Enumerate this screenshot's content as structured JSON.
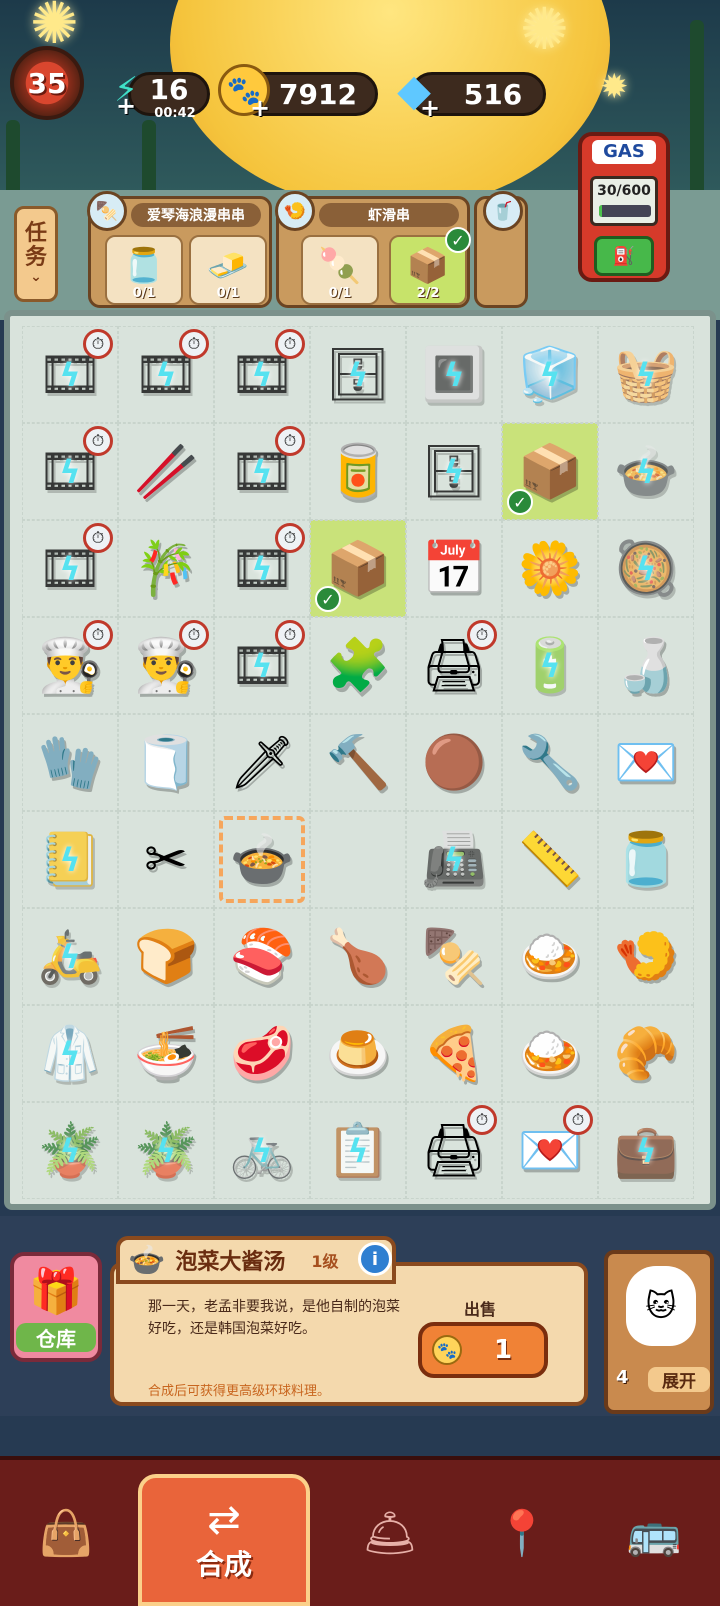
{
  "hud": {
    "level": "35",
    "energy": {
      "value": "16",
      "timer": "00:42",
      "icon": "lightning-icon"
    },
    "coins": {
      "value": "7912",
      "icon": "paw-coin-icon"
    },
    "gems": {
      "value": "516",
      "icon": "diamond-icon"
    }
  },
  "tasks": {
    "tab_label_top": "任",
    "tab_label_bottom": "务",
    "orders": [
      {
        "title": "爱琴海浪漫串串",
        "requirements": [
          {
            "icon": "jar-icon",
            "count": "0/1"
          },
          {
            "icon": "tofu-icon",
            "count": "0/1"
          }
        ]
      },
      {
        "title": "虾滑串",
        "requirements": [
          {
            "icon": "shrimp-ball-icon",
            "count": "0/1"
          },
          {
            "icon": "box-icon",
            "count": "2/2"
          }
        ]
      }
    ]
  },
  "gas": {
    "label": "GAS",
    "value": "30/600",
    "fill_fraction": 0.05
  },
  "board": {
    "rows": [
      [
        "film-roll",
        "film-roll",
        "film-roll",
        "blue-cabinet",
        "oven",
        "fridge",
        "veggie-basket"
      ],
      [
        "film-roll",
        "sushi-roll",
        "film-roll",
        "red-can",
        "blue-cabinet",
        "cardboard-box",
        "hotpot"
      ],
      [
        "film-roll",
        "bamboo",
        "film-roll",
        "cardboard-box",
        "calendar",
        "flower-packet",
        "cooking-pot"
      ],
      [
        "chef-hat",
        "chef-hat",
        "film-roll",
        "stamp",
        "printer",
        "battery",
        "sauce-bottle"
      ],
      [
        "oven-mitt",
        "towel",
        "kunai",
        "hammer",
        "meatball",
        "pliers",
        "postcards"
      ],
      [
        "notebook",
        "scissors",
        "stew-pot",
        "empty",
        "toaster",
        "tape-measure",
        "kimchi-jar"
      ],
      [
        "scooter",
        "toast",
        "sushi",
        "roast-chicken",
        "skewers",
        "fried-rice",
        "shrimp-bowl"
      ],
      [
        "chef-coat",
        "noodle-bowl",
        "braised-pork",
        "pudding",
        "pizza",
        "curry",
        "croissant"
      ],
      [
        "bonsai",
        "bonsai",
        "bicycle",
        "clipboard",
        "printer",
        "postcards",
        "blue-bag"
      ]
    ]
  },
  "info": {
    "item_name": "泡菜大酱汤",
    "item_level": "1级",
    "description": "那一天，老孟非要我说，是他自制的泡菜好吃，还是韩国泡菜好吃。",
    "hint": "合成后可获得更高级环球料理。",
    "sell_label": "出售",
    "sell_price": "1"
  },
  "warehouse": {
    "label": "仓库"
  },
  "expand": {
    "count": "4",
    "label": "展开"
  },
  "nav": {
    "merge_label": "合成"
  }
}
